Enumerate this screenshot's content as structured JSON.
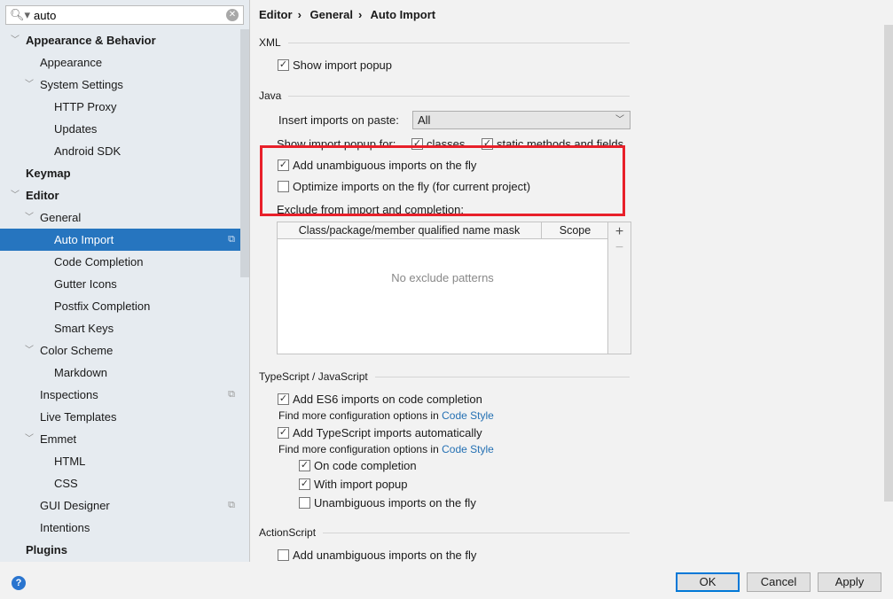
{
  "search": {
    "value": "auto"
  },
  "tree": [
    {
      "label": "Appearance & Behavior",
      "level": 0,
      "bold": true,
      "arrow": true
    },
    {
      "label": "Appearance",
      "level": 1
    },
    {
      "label": "System Settings",
      "level": 1,
      "arrow": true
    },
    {
      "label": "HTTP Proxy",
      "level": 2
    },
    {
      "label": "Updates",
      "level": 2
    },
    {
      "label": "Android SDK",
      "level": 2
    },
    {
      "label": "Keymap",
      "level": 0,
      "bold": true
    },
    {
      "label": "Editor",
      "level": 0,
      "bold": true,
      "arrow": true
    },
    {
      "label": "General",
      "level": 1,
      "arrow": true
    },
    {
      "label": "Auto Import",
      "level": 2,
      "selected": true,
      "copy": true
    },
    {
      "label": "Code Completion",
      "level": 2
    },
    {
      "label": "Gutter Icons",
      "level": 2
    },
    {
      "label": "Postfix Completion",
      "level": 2
    },
    {
      "label": "Smart Keys",
      "level": 2
    },
    {
      "label": "Color Scheme",
      "level": 1,
      "arrow": true
    },
    {
      "label": "Markdown",
      "level": 2
    },
    {
      "label": "Inspections",
      "level": 1,
      "copy": true
    },
    {
      "label": "Live Templates",
      "level": 1
    },
    {
      "label": "Emmet",
      "level": 1,
      "arrow": true
    },
    {
      "label": "HTML",
      "level": 2
    },
    {
      "label": "CSS",
      "level": 2
    },
    {
      "label": "GUI Designer",
      "level": 1,
      "copy": true
    },
    {
      "label": "Intentions",
      "level": 1
    },
    {
      "label": "Plugins",
      "level": 0,
      "bold": true
    }
  ],
  "breadcrumb": [
    "Editor",
    "General",
    "Auto Import"
  ],
  "xml": {
    "title": "XML",
    "show_popup": {
      "label": "Show import popup",
      "checked": true
    }
  },
  "java": {
    "title": "Java",
    "insert_label": "Insert imports on paste:",
    "insert_value": "All",
    "show_popup_label": "Show import popup for:",
    "classes": {
      "label": "classes",
      "checked": true
    },
    "static": {
      "label": "static methods and fields",
      "checked": true
    },
    "add_unambiguous": {
      "label": "Add unambiguous imports on the fly",
      "checked": true
    },
    "optimize": {
      "label": "Optimize imports on the fly (for current project)",
      "checked": false
    },
    "exclude_label": "Exclude from import and completion:",
    "table": {
      "columns": [
        "Class/package/member qualified name mask",
        "Scope"
      ],
      "empty": "No exclude patterns",
      "add": "+",
      "remove": "−"
    }
  },
  "ts": {
    "title": "TypeScript / JavaScript",
    "es6": {
      "label": "Add ES6 imports on code completion",
      "checked": true
    },
    "more1": "Find more configuration options in ",
    "link": "Code Style",
    "tsauto": {
      "label": "Add TypeScript imports automatically",
      "checked": true
    },
    "more2": "Find more configuration options in ",
    "on_completion": {
      "label": "On code completion",
      "checked": true
    },
    "with_popup": {
      "label": "With import popup",
      "checked": true
    },
    "unambiguous": {
      "label": "Unambiguous imports on the fly",
      "checked": false
    }
  },
  "as": {
    "title": "ActionScript",
    "unambiguous": {
      "label": "Add unambiguous imports on the fly",
      "checked": false
    }
  },
  "buttons": {
    "ok": "OK",
    "cancel": "Cancel",
    "apply": "Apply",
    "help": "?"
  },
  "colors": {
    "selection": "#2675bf",
    "highlight": "#e8202a",
    "link": "#2470b3"
  }
}
